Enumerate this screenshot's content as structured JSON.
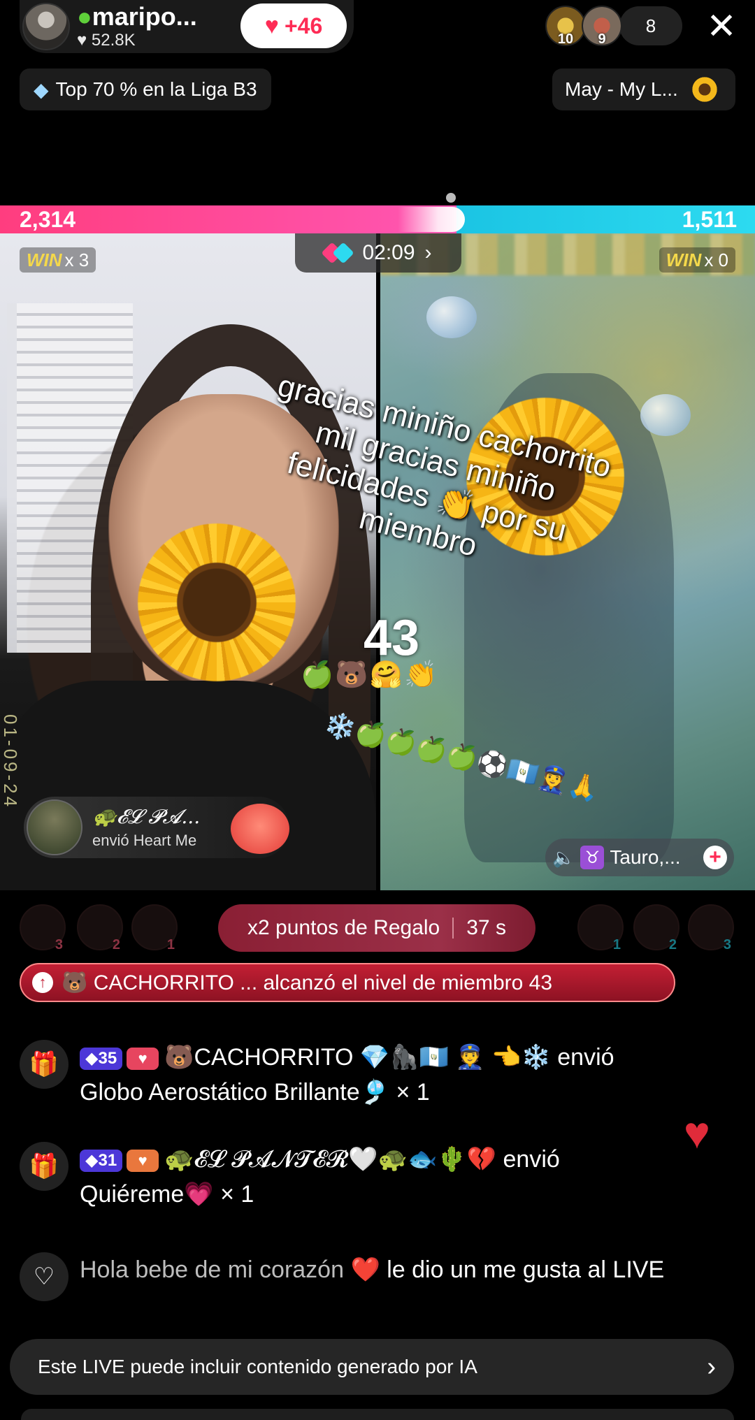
{
  "header": {
    "host_name": "maripo...",
    "host_likes": "52.8K",
    "follow_label": "+46",
    "viewer_badges": [
      "10",
      "9"
    ],
    "viewer_count": "8",
    "close_label": "✕"
  },
  "league": {
    "label": "Top 70 % en la Liga B3"
  },
  "music": {
    "label": "May - My L..."
  },
  "battle": {
    "score_left": "2,314",
    "score_right": "1,511",
    "win_left_label": "WIN",
    "win_left_count": "x 3",
    "win_right_label": "WIN",
    "win_right_count": "x 0",
    "timer": "02:09",
    "left_fraction": 0.605
  },
  "overlay": {
    "text_lines": [
      "gracias miniño cachorrito",
      "mil gracias miniño",
      "felicidades 👏 por su",
      "miembro"
    ],
    "number": "43",
    "emoji_row1": "🍏🐻🤗👏",
    "emoji_row2": "❄️🍏🍏🍏🍏⚽🇬🇹👮‍♀️🙏"
  },
  "gift_toast": {
    "sender": "🐢𝓔𝓛 𝓟𝓐...",
    "action": "envió Heart Me"
  },
  "opponent": {
    "name": "Tauro,...",
    "zodiac": "♉"
  },
  "bonus": {
    "label": "x2 puntos de Regalo",
    "countdown": "37 s",
    "left_ranks": [
      "3",
      "2",
      "1"
    ],
    "right_ranks": [
      "1",
      "2",
      "3"
    ]
  },
  "level_banner": {
    "text": "🐻 CACHORRITO ... alcanzó el nivel de miembro 43"
  },
  "chat": [
    {
      "icon": "gift-icon",
      "level": "35",
      "user": "🐻CACHORRITO 💎🦍🇬🇹 👮 👈❄️",
      "action": "envió",
      "gift": "Globo Aerostático Brillante🎐",
      "count": "× 1"
    },
    {
      "icon": "gift-icon",
      "level": "31",
      "user": "🐢𝓔𝓛 𝓟𝓐𝓝𝓣𝓔𝓡🤍🐢🐟🌵💔",
      "action": "envió",
      "gift": "Quiéreme💗",
      "count": "× 1"
    },
    {
      "icon": "heart-outline-icon",
      "user": "Hola bebe de mi corazón ❤️",
      "action": "le dio un me gusta al LIVE"
    }
  ],
  "ai_notice": {
    "text": "Este LIVE puede incluir contenido generado por IA"
  },
  "colors": {
    "left_team": "#ff3d7f",
    "right_team": "#2ddaf0",
    "accent": "#fe2c55"
  }
}
